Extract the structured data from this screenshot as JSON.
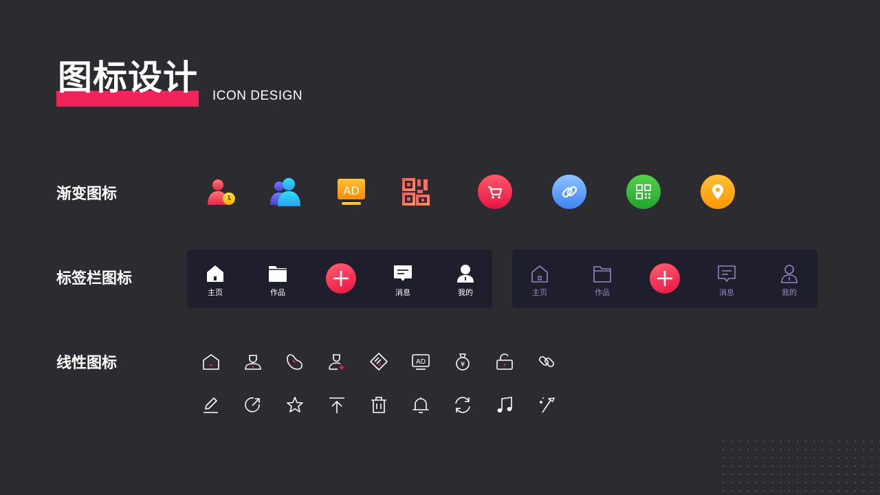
{
  "header": {
    "title_cn": "图标设计",
    "title_en": "ICON DESIGN",
    "accent_color": "#f0245a"
  },
  "sections": {
    "gradient": {
      "label": "渐变图标"
    },
    "tabbar": {
      "label": "标签栏图标"
    },
    "linear": {
      "label": "线性图标"
    }
  },
  "gradient_icons": [
    "user-clock-icon",
    "users-icon",
    "ad-screen-icon",
    "qr-code-icon",
    "cart-circle-icon",
    "link-circle-icon",
    "qr-circle-icon",
    "location-circle-icon"
  ],
  "tabbars": [
    {
      "style": "solid",
      "tabs": [
        {
          "icon": "home-icon",
          "label": "主页"
        },
        {
          "icon": "folder-icon",
          "label": "作品"
        },
        {
          "icon": "plus-icon",
          "label": ""
        },
        {
          "icon": "message-icon",
          "label": "消息"
        },
        {
          "icon": "profile-icon",
          "label": "我的"
        }
      ]
    },
    {
      "style": "line",
      "tabs": [
        {
          "icon": "home-icon",
          "label": "主页"
        },
        {
          "icon": "folder-icon",
          "label": "作品"
        },
        {
          "icon": "plus-icon",
          "label": ""
        },
        {
          "icon": "message-icon",
          "label": "消息"
        },
        {
          "icon": "profile-icon",
          "label": "我的"
        }
      ]
    }
  ],
  "linear_icons": {
    "row1": [
      "home-icon",
      "user-icon",
      "bean-icon",
      "user-add-icon",
      "ticket-icon",
      "ad-icon",
      "money-bag-icon",
      "unlock-icon",
      "link-icon"
    ],
    "row2": [
      "edit-icon",
      "share-icon",
      "star-icon",
      "to-top-icon",
      "trash-icon",
      "bell-icon",
      "refresh-icon",
      "music-icon",
      "magic-wand-icon"
    ]
  }
}
